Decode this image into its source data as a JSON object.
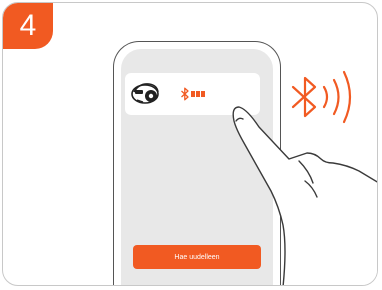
{
  "step": {
    "number": "4"
  },
  "phone": {
    "retry_button_label": "Hae uudelleen"
  },
  "icons": {
    "mower": "robot-mower-icon",
    "bluetooth": "bluetooth-icon",
    "battery": "battery-icon",
    "hand": "pointing-hand-icon"
  },
  "colors": {
    "accent": "#f15a22",
    "outline": "#555555",
    "screen": "#e8e8e8"
  }
}
